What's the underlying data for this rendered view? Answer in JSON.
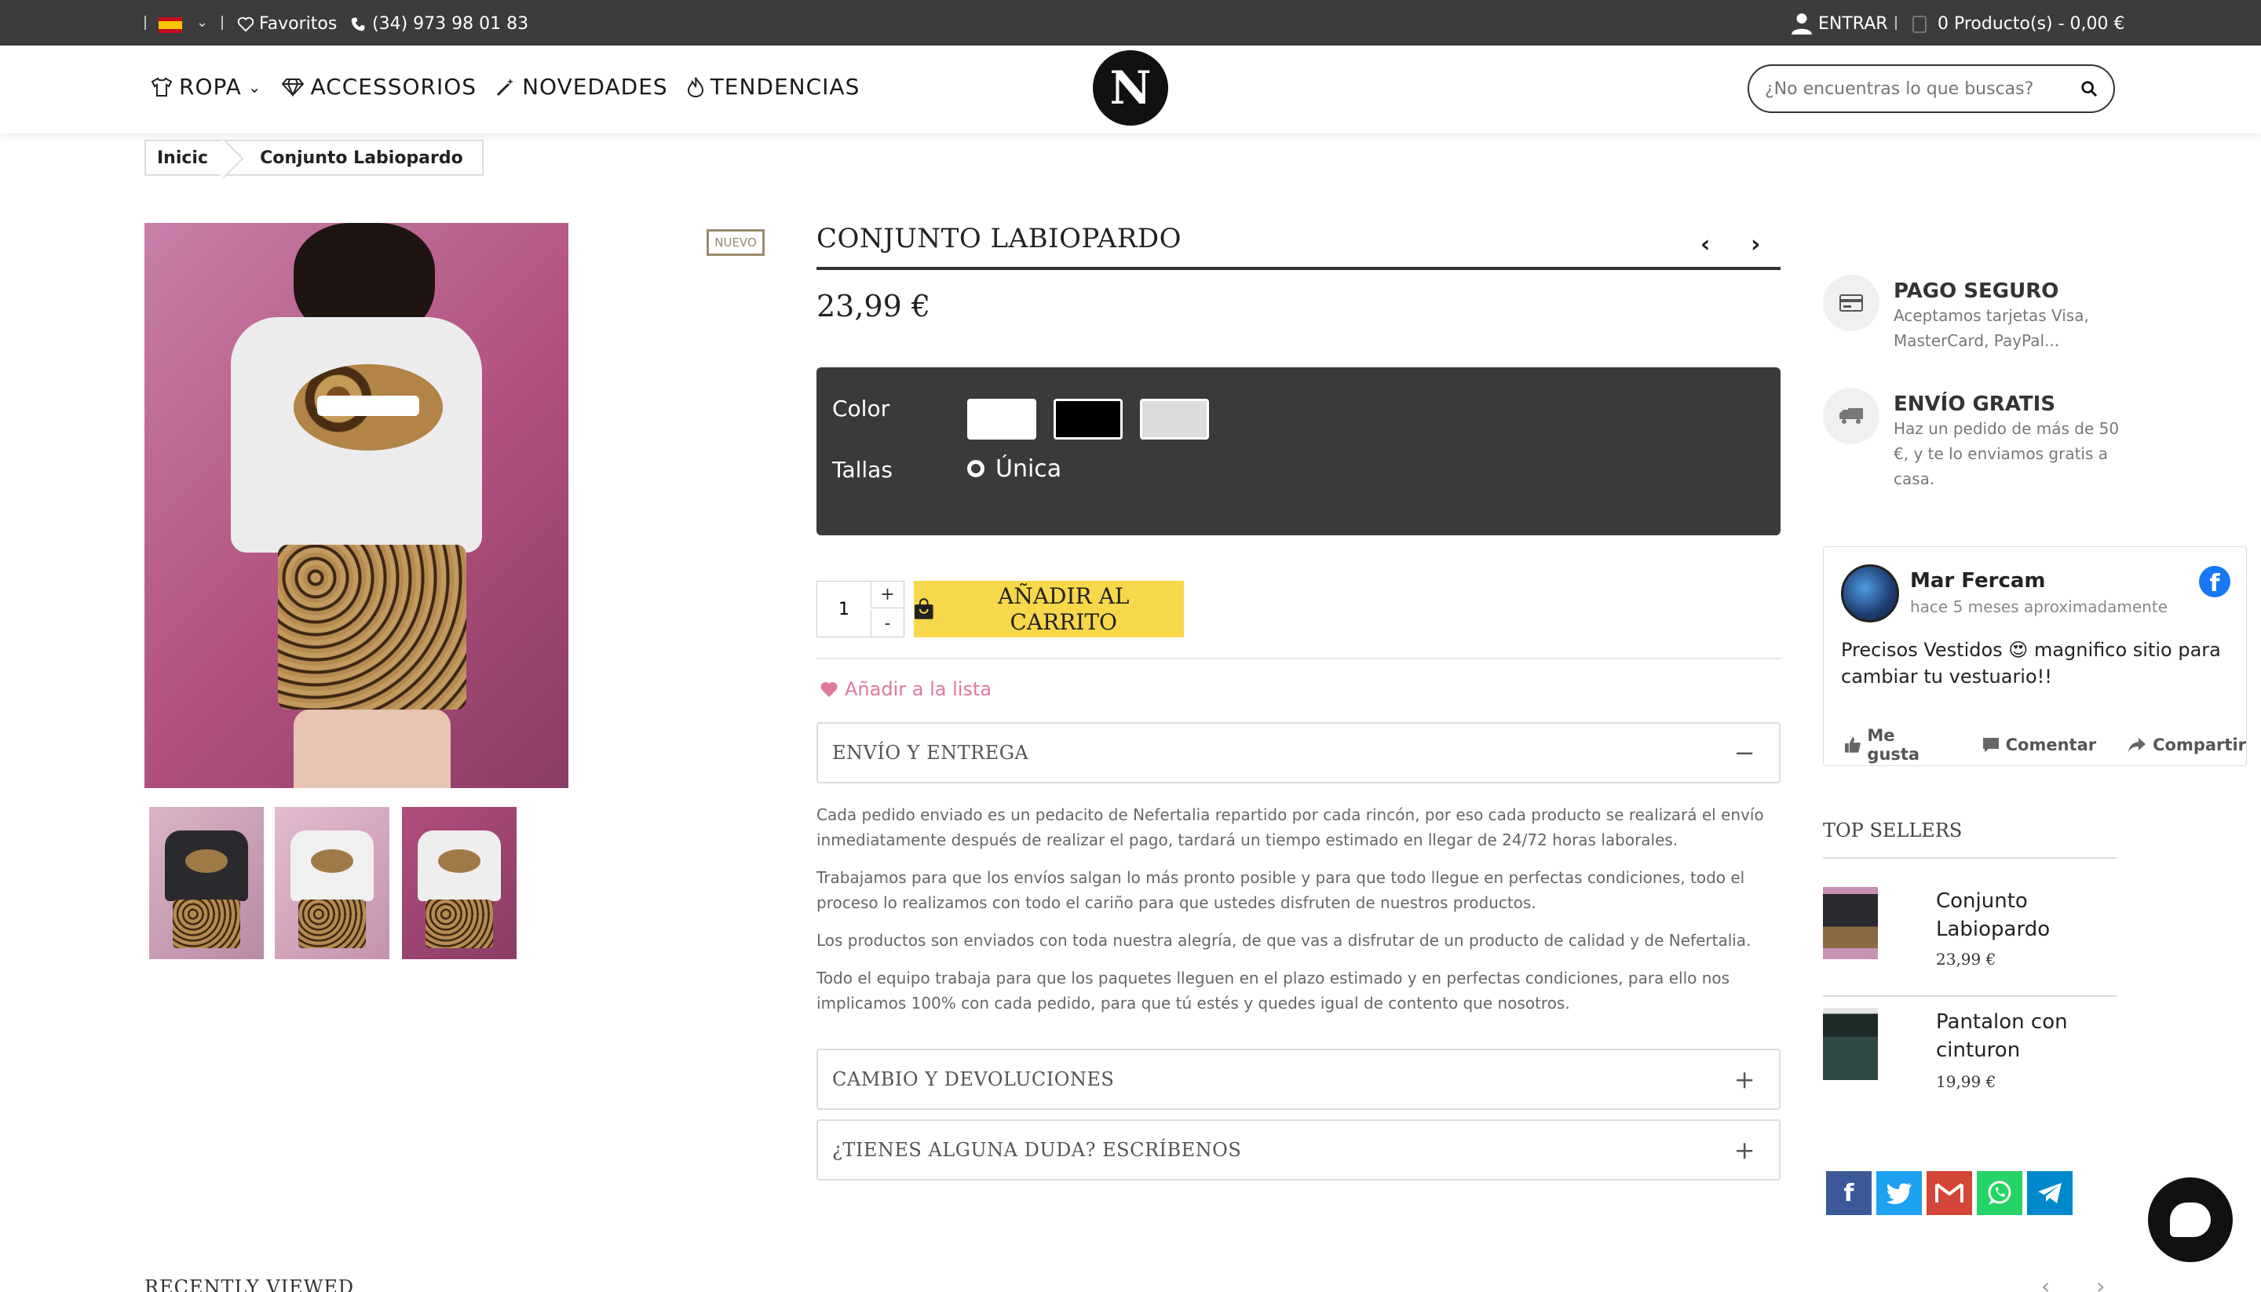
{
  "topbar": {
    "favorites": "Favoritos",
    "phone": "(34) 973 98 01 83",
    "login": "ENTRAR",
    "cart": "0 Producto(s) - 0,00 €"
  },
  "header": {
    "nav": [
      {
        "label": "ROPA"
      },
      {
        "label": "ACCESSORIOS"
      },
      {
        "label": "NOVEDADES"
      },
      {
        "label": "TENDENCIAS"
      }
    ],
    "logo_letter": "N",
    "search_placeholder": "¿No encuentras lo que buscas?"
  },
  "breadcrumb": [
    "Inicio",
    "Conjunto Labiopardo"
  ],
  "product": {
    "badge": "NUEVO",
    "title": "CONJUNTO LABIOPARDO",
    "price": "23,99 €",
    "color_label": "Color",
    "swatch_colors": [
      "#ffffff",
      "#000000",
      "#dddddd"
    ],
    "size_label": "Tallas",
    "size_option": "Única",
    "quantity": "1",
    "add_to_cart": "AÑADIR AL CARRITO",
    "wishlist": "Añadir a la lista"
  },
  "accordion": {
    "shipping_title": "ENVÍO Y ENTREGA",
    "shipping_paragraphs": [
      "Cada pedido enviado es un pedacito de Nefertalia repartido por cada rincón, por eso cada producto se realizará el envío inmediatamente después de realizar el pago, tardará un tiempo estimado en llegar de 24/72 horas laborales.",
      "Trabajamos para que los envíos salgan lo más pronto posible y para que todo llegue en perfectas condiciones, todo el proceso lo realizamos con todo el cariño para que ustedes disfruten de nuestros productos.",
      "Los productos son enviados con toda nuestra alegría, de que vas a disfrutar de un producto de calidad y de Nefertalia.",
      "Todo el equipo trabaja para que los paquetes lleguen en el plazo estimado y en perfectas condiciones, para ello nos implicamos 100% con cada pedido, para que tú estés y quedes igual de contento que nosotros."
    ],
    "returns_title": "CAMBIO Y DEVOLUCIONES",
    "questions_title": "¿TIENES ALGUNA DUDA? ESCRÍBENOS"
  },
  "features": [
    {
      "title": "PAGO SEGURO",
      "desc": "Aceptamos tarjetas Visa, MasterCard, PayPal..."
    },
    {
      "title": "ENVÍO GRATIS",
      "desc": "Haz un pedido de más de 50 €, y te lo enviamos gratis a casa."
    }
  ],
  "review": {
    "name": "Mar Fercam",
    "time": "hace 5 meses aproximadamente",
    "message": "Precisos Vestidos 😍 magnifico sitio para cambiar tu vestuario!!",
    "like": "Me gusta",
    "comment": "Comentar",
    "share": "Compartir"
  },
  "top_sellers": {
    "title": "TOP SELLERS",
    "items": [
      {
        "name": "Conjunto Labiopardo",
        "price": "23,99 €"
      },
      {
        "name": "Pantalon con cinturon",
        "price": "19,99 €"
      }
    ]
  },
  "share_colors": {
    "facebook": "#3b5998",
    "twitter": "#1da1f2",
    "gmail": "#d44638",
    "whatsapp": "#25d366",
    "telegram": "#0088cc"
  },
  "recently_viewed": "RECENTLY VIEWED"
}
